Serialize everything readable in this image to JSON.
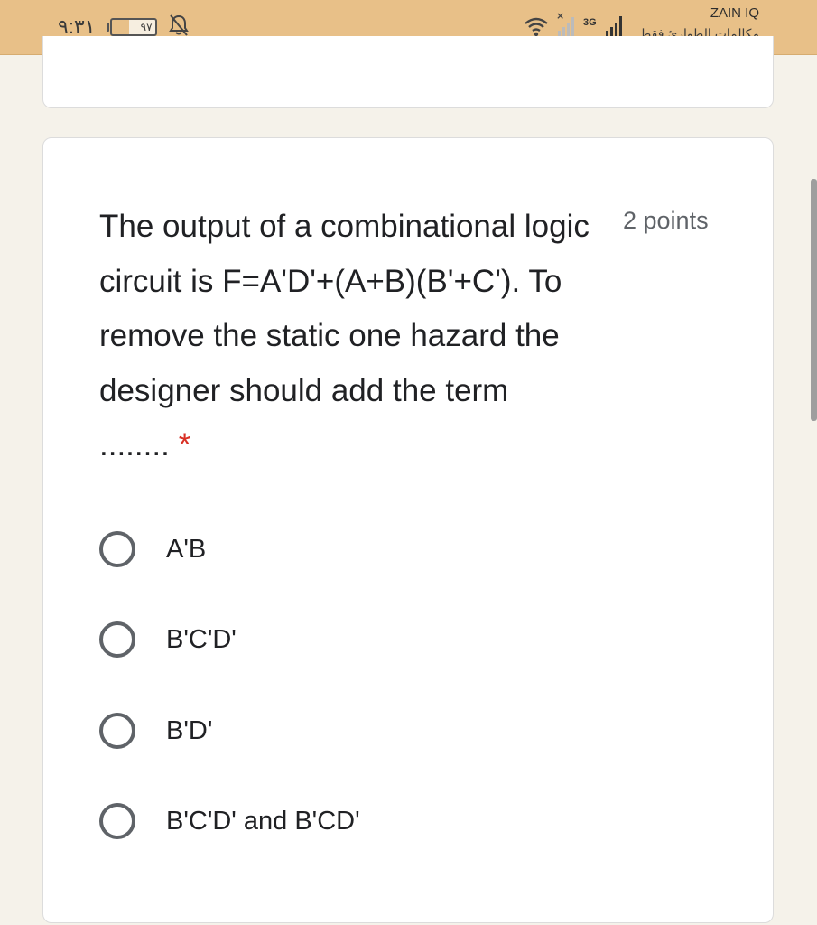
{
  "status_bar": {
    "time": "٩:٣١",
    "battery_level": "٩٧",
    "network_type": "3G",
    "carrier": "ZAIN IQ",
    "emergency_note": "مكالمات الطوارئ فقط"
  },
  "question": {
    "text": "The output of a combinational logic circuit is F=A'D'+(A+B)(B'+C'). To remove the static one hazard the designer should add the term ........",
    "required_marker": "*",
    "points": "2 points"
  },
  "options": [
    {
      "label": "A'B"
    },
    {
      "label": "B'C'D'"
    },
    {
      "label": "B'D'"
    },
    {
      "label": "B'C'D' and B'CD'"
    }
  ]
}
